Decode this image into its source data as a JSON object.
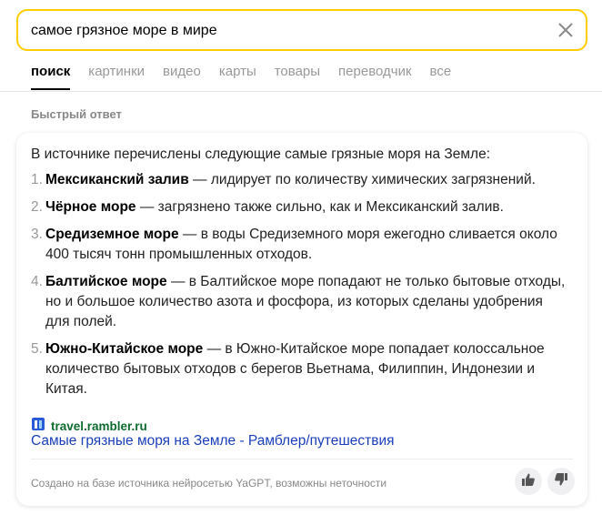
{
  "search": {
    "query": "самое грязное море в мире",
    "clear_icon": "close-icon"
  },
  "tabs": [
    {
      "label": "поиск",
      "active": true
    },
    {
      "label": "картинки",
      "active": false
    },
    {
      "label": "видео",
      "active": false
    },
    {
      "label": "карты",
      "active": false
    },
    {
      "label": "товары",
      "active": false
    },
    {
      "label": "переводчик",
      "active": false
    },
    {
      "label": "все",
      "active": false
    }
  ],
  "quick_answer": {
    "title": "Быстрый ответ",
    "intro": "В источнике перечислены следующие самые грязные моря на Земле:",
    "items": [
      {
        "num": "1.",
        "name": "Мексиканский залив",
        "text": " — лидирует по количеству химических загрязнений."
      },
      {
        "num": "2.",
        "name": "Чёрное море",
        "text": " — загрязнено также сильно, как и Мексиканский залив."
      },
      {
        "num": "3.",
        "name": "Средиземное море",
        "text": " — в воды Средиземного моря ежегодно сливается около 400 тысяч тонн промышленных отходов."
      },
      {
        "num": "4.",
        "name": "Балтийское море",
        "text": " — в Балтийское море попадают не только бытовые отходы, но и большое количество азота и фосфора, из которых сделаны удобрения для полей."
      },
      {
        "num": "5.",
        "name": "Южно-Китайское море",
        "text": " — в Южно-Китайское море попадает колоссальное количество бытовых отходов с берегов Вьетнама, Филиппин, Индонезии и Китая."
      }
    ],
    "source": {
      "host": "travel.rambler.ru",
      "link_text": "Самые грязные моря на Земле - Рамблер/путешествия",
      "icon": "site-favicon-icon"
    },
    "footer_note": "Создано на базе источника нейросетью YaGPT, возможны неточности",
    "vote_up_icon": "thumbs-up-icon",
    "vote_down_icon": "thumbs-down-icon"
  },
  "colors": {
    "accent": "#ffcc00",
    "link": "#1a3fb8",
    "source_host": "#0d6b2f"
  }
}
